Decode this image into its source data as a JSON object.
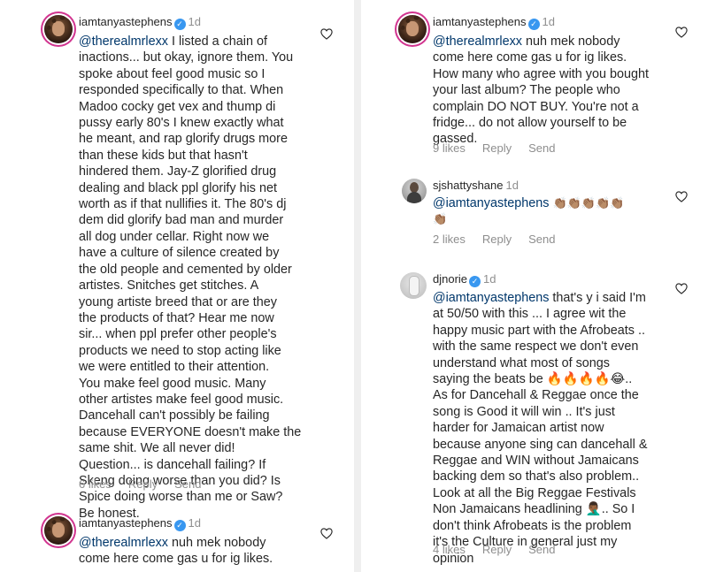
{
  "left": {
    "comment1": {
      "username": "iamtanyastephens",
      "time": "1d",
      "mention": "@therealmrlexx",
      "lines": [
        " I listed a chain of",
        "inactions... but okay, ignore them. You",
        "spoke about feel good music so I",
        "responded specifically to that. When",
        "Madoo cocky get vex and thump di",
        "pussy early 80's I knew exactly what",
        "he meant, and rap glorify drugs more",
        "than these kids but that hasn't",
        "hindered them. Jay-Z glorified drug",
        "dealing and black ppl glorify his net",
        "worth as if that nullifies it. The 80's dj",
        "dem did glorify bad man and murder",
        "all dog under cellar. Right now we",
        "have a culture of silence created by",
        "the old people and cemented by older",
        "artistes. Snitches get stitches. A",
        "young artiste breed that or are they",
        "the products of that? Hear me now",
        "sir... when ppl prefer other people's",
        "products we need to stop acting like",
        "we were entitled to their attention.",
        "You make feel good music. Many",
        "other artistes make feel good music.",
        "Dancehall can't possibly be failing",
        "because EVERYONE doesn't make the",
        "same shit. We all never did!",
        "Question... is dancehall failing? If",
        "Skeng doing worse than you did? Is",
        "Spice doing worse than me or Saw?",
        "Be honest."
      ],
      "likes": "6 likes",
      "reply": "Reply",
      "send": "Send"
    },
    "comment2": {
      "username": "iamtanyastephens",
      "time": "1d",
      "mention": "@therealmrlexx",
      "lines": [
        " nuh mek nobody",
        "come here come gas u for ig likes."
      ]
    }
  },
  "right": {
    "comment1": {
      "username": "iamtanyastephens",
      "time": "1d",
      "mention": "@therealmrlexx",
      "lines": [
        " nuh mek nobody",
        "come here come gas u for ig likes.",
        "How many who agree with you bought",
        "your last album? The people who",
        "complain DO NOT BUY. You're not a",
        "fridge... do not allow yourself to be",
        "gassed."
      ],
      "likes": "9 likes",
      "reply": "Reply",
      "send": "Send"
    },
    "comment2": {
      "username": "sjshattyshane",
      "time": "1d",
      "mention": "@iamtanyastephens",
      "emoji_line1": " 👏🏽👏🏽👏🏽👏🏽👏🏽",
      "emoji_line2": "👏🏽",
      "likes": "2 likes",
      "reply": "Reply",
      "send": "Send"
    },
    "comment3": {
      "username": "djnorie",
      "time": "1d",
      "mention": "@iamtanyastephens",
      "lines": [
        " that's y i said I'm",
        "at 50/50 with this ... I agree wit the",
        "happy music part with the Afrobeats ..",
        "with the same respect we don't even",
        "understand what most of songs",
        "saying the beats be 🔥🔥🔥🔥😂..",
        "As for Dancehall & Reggae once the",
        "song is Good it will win .. It's just",
        "harder for Jamaican artist now",
        "because anyone sing can dancehall &",
        "Reggae and WIN without Jamaicans",
        "backing dem so that's also problem..",
        "Look at all the Big Reggae Festivals",
        "Non Jamaicans headlining 🤦🏾‍♂️.. So I",
        "don't think Afrobeats is the problem",
        "it's the Culture in general just my",
        "opinion"
      ],
      "likes": "4 likes",
      "reply": "Reply",
      "send": "Send"
    }
  },
  "icons": {
    "verified": "verified-badge-icon",
    "heart": "heart-outline-icon"
  },
  "colors": {
    "mention": "#00376b",
    "verified": "#3897f0",
    "meta": "#8e8e8e",
    "text": "#262626"
  }
}
